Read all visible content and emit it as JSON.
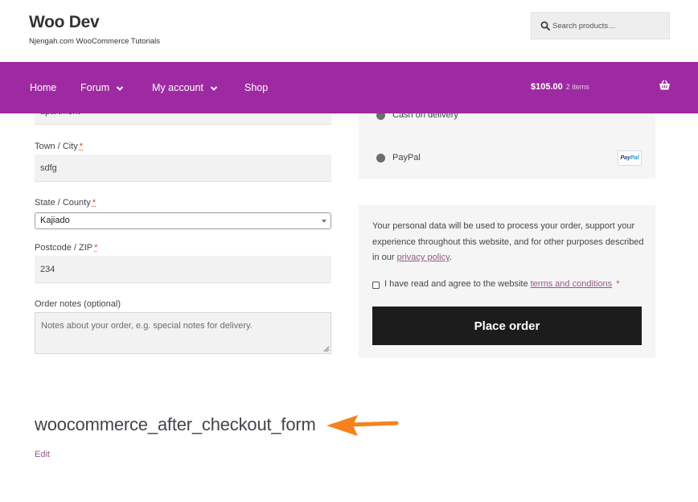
{
  "header": {
    "site_title": "Woo Dev",
    "site_description": "Njengah.com WooCommerce Tutorials",
    "search_placeholder": "Search products…",
    "search_icon": "search-icon"
  },
  "nav": {
    "items": [
      {
        "label": "Home",
        "has_dropdown": false
      },
      {
        "label": "Forum",
        "has_dropdown": true
      },
      {
        "label": "My account",
        "has_dropdown": true
      },
      {
        "label": "Shop",
        "has_dropdown": false
      }
    ],
    "cart_total": "$105.00",
    "cart_count": "2 items",
    "cart_icon": "basket-icon",
    "background_color": "#9e2aa2"
  },
  "billing_form": {
    "cut_off_value": "apartment",
    "town": {
      "label": "Town / City",
      "required_mark": "*",
      "value": "sdfg"
    },
    "state": {
      "label": "State / County",
      "required_mark": "*",
      "value": "Kajiado"
    },
    "postcode": {
      "label": "Postcode / ZIP",
      "required_mark": "*",
      "value": "234"
    },
    "order_notes": {
      "label": "Order notes (optional)",
      "placeholder": "Notes about your order, e.g. special notes for delivery."
    }
  },
  "payment": {
    "methods": [
      {
        "label": "Cash on delivery"
      },
      {
        "label": "PayPal",
        "logo_text_1": "Pay",
        "logo_text_2": "Pal"
      }
    ]
  },
  "terms": {
    "privacy_text_before": "Your personal data will be used to process your order, support your experience throughout this website, and for other purposes described in our ",
    "privacy_link": "privacy policy",
    "privacy_text_after": ".",
    "agree_text": "I have read and agree to the website ",
    "terms_link": "terms and conditions",
    "required_mark": "*",
    "place_order_label": "Place order"
  },
  "hook": {
    "title": "woocommerce_after_checkout_form",
    "edit_label": "Edit",
    "arrow_color": "#f5821f"
  }
}
